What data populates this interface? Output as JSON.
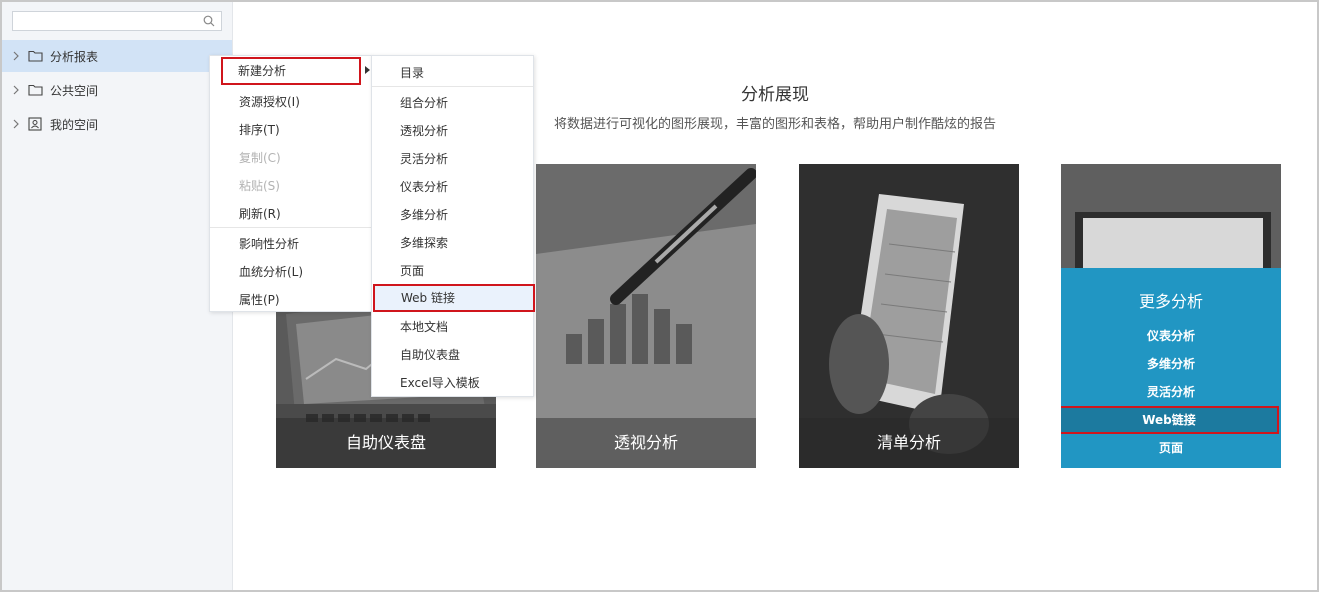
{
  "search": {
    "placeholder": "",
    "value": ""
  },
  "sidebar": {
    "items": [
      {
        "label": "分析报表",
        "icon": "folder-icon",
        "active": true
      },
      {
        "label": "公共空间",
        "icon": "folder-icon",
        "active": false
      },
      {
        "label": "我的空间",
        "icon": "user-space-icon",
        "active": false
      }
    ]
  },
  "context_menu": {
    "items": [
      {
        "label": "新建分析",
        "has_submenu": true,
        "highlighted": true
      },
      {
        "label": "资源授权(I)"
      },
      {
        "label": "排序(T)"
      },
      {
        "label": "复制(C)",
        "disabled": true
      },
      {
        "label": "粘贴(S)",
        "disabled": true
      },
      {
        "label": "刷新(R)"
      },
      {
        "label": "影响性分析"
      },
      {
        "label": "血统分析(L)"
      },
      {
        "label": "属性(P)"
      }
    ]
  },
  "submenu": {
    "items": [
      {
        "label": "目录"
      },
      {
        "label": "组合分析"
      },
      {
        "label": "透视分析"
      },
      {
        "label": "灵活分析"
      },
      {
        "label": "仪表分析"
      },
      {
        "label": "多维分析"
      },
      {
        "label": "多维探索"
      },
      {
        "label": "页面"
      },
      {
        "label": "Web 链接",
        "selected": true
      },
      {
        "label": "本地文档"
      },
      {
        "label": "自助仪表盘"
      },
      {
        "label": "Excel导入模板"
      }
    ]
  },
  "main": {
    "title": "分析展现",
    "subtitle": "将数据进行可视化的图形展现，丰富的图形和表格，帮助用户制作酷炫的报告",
    "cards": [
      {
        "caption": "自助仪表盘"
      },
      {
        "caption": "透视分析"
      },
      {
        "caption": "清单分析"
      }
    ],
    "more": {
      "title": "更多分析",
      "items": [
        {
          "label": "仪表分析"
        },
        {
          "label": "多维分析"
        },
        {
          "label": "灵活分析"
        },
        {
          "label": "Web链接",
          "selected": true
        },
        {
          "label": "页面"
        }
      ]
    }
  },
  "colors": {
    "accent": "#2196c3",
    "highlight_border": "#d0151c",
    "sidebar_active": "#d2e3f6"
  }
}
